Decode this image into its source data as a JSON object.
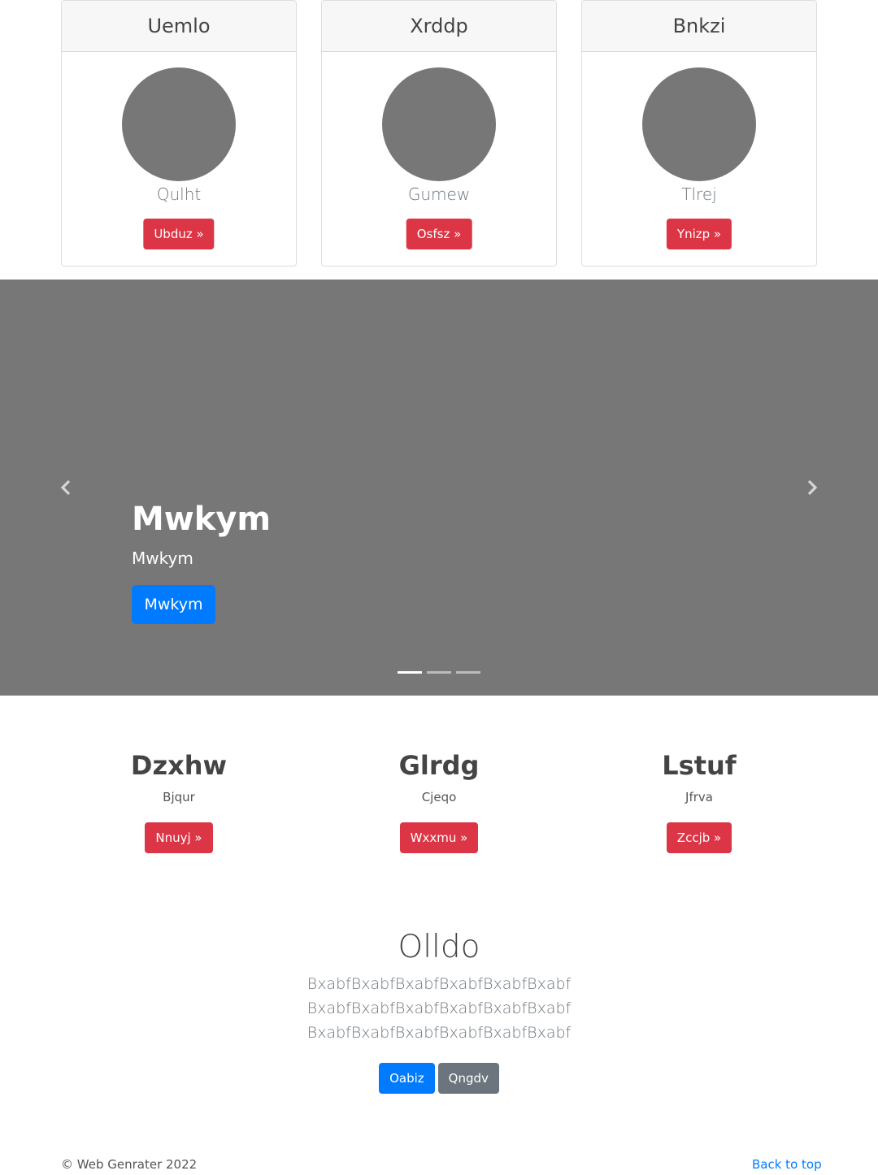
{
  "cards": [
    {
      "title": "Uemlo",
      "subtitle": "Qulht",
      "button": "Ubduz »"
    },
    {
      "title": "Xrddp",
      "subtitle": "Gumew",
      "button": "Osfsz »"
    },
    {
      "title": "Bnkzi",
      "subtitle": "Tlrej",
      "button": "Ynizp »"
    }
  ],
  "carousel": {
    "title": "Mwkym",
    "subtitle": "Mwkym",
    "button": "Mwkym",
    "slide_count": 3,
    "active_index": 0,
    "background_color": "#777777",
    "prev_icon": "chevron-left-icon",
    "next_icon": "chevron-right-icon"
  },
  "features": [
    {
      "title": "Dzxhw",
      "text": "Bjqur",
      "button": "Nnuyj »"
    },
    {
      "title": "Glrdg",
      "text": "Cjeqo",
      "button": "Wxxmu »"
    },
    {
      "title": "Lstuf",
      "text": "Jfrva",
      "button": "Zccjb »"
    }
  ],
  "jumbotron": {
    "heading": "Olldo",
    "text": "BxabfBxabfBxabfBxabfBxabfBxabf BxabfBxabfBxabfBxabfBxabfBxabf BxabfBxabfBxabfBxabfBxabfBxabf",
    "primary_button": "Oabiz",
    "secondary_button": "Qngdv"
  },
  "footer": {
    "copyright": "© Web Genrater 2022",
    "back_to_top": "Back to top"
  },
  "colors": {
    "danger": "#dc3545",
    "primary": "#007bff",
    "secondary": "#6c757d",
    "placeholder": "#777777"
  }
}
